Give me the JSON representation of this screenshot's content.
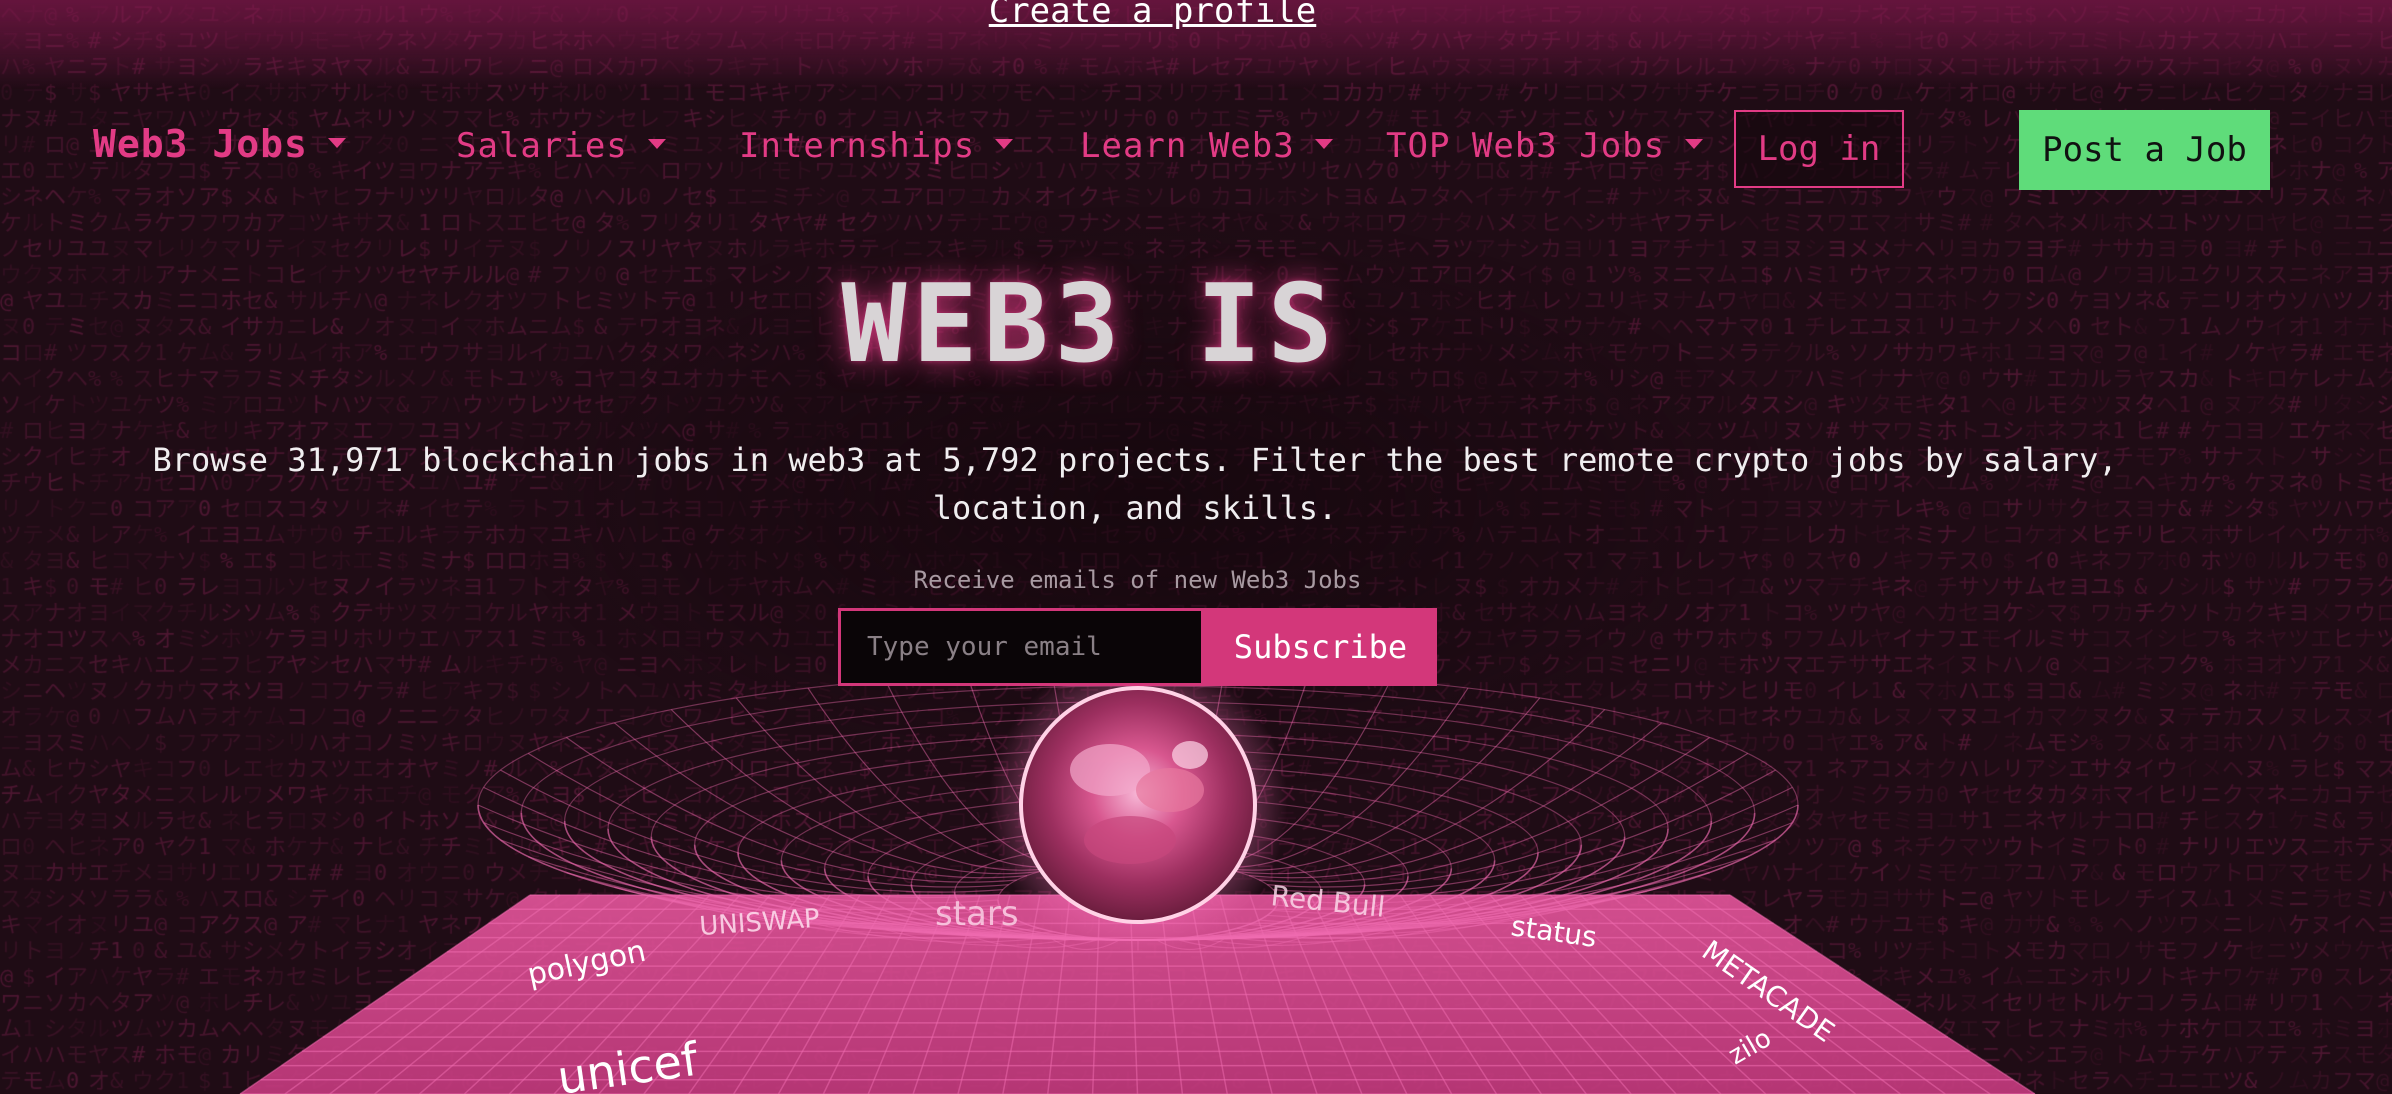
{
  "banner": {
    "create_profile_label": "Create a profile"
  },
  "nav": {
    "brand_label": "Web3 Jobs",
    "items": [
      {
        "label": "Salaries"
      },
      {
        "label": "Internships"
      },
      {
        "label": "Learn Web3"
      },
      {
        "label": "TOP Web3 Jobs"
      }
    ],
    "login_label": "Log in",
    "post_job_label": "Post a Job"
  },
  "hero": {
    "title": "WEB3 IS",
    "subtitle_line1": "Browse 31,971 blockchain jobs in web3 at 5,792 projects. Filter the best remote crypto jobs by salary,",
    "subtitle_line2": "location, and skills."
  },
  "subscribe": {
    "caption": "Receive emails of new Web3 Jobs",
    "email_placeholder": "Type your email",
    "button_label": "Subscribe"
  },
  "logos": [
    "polygon",
    "UNISWAP",
    "stars",
    "Red Bull",
    "status",
    "METACADE",
    "unicef",
    "zilo"
  ],
  "colors": {
    "accent": "#e23b85",
    "cta_green": "#5fdc7a",
    "background": "#1a0910",
    "mesh": "#f06bb0"
  }
}
